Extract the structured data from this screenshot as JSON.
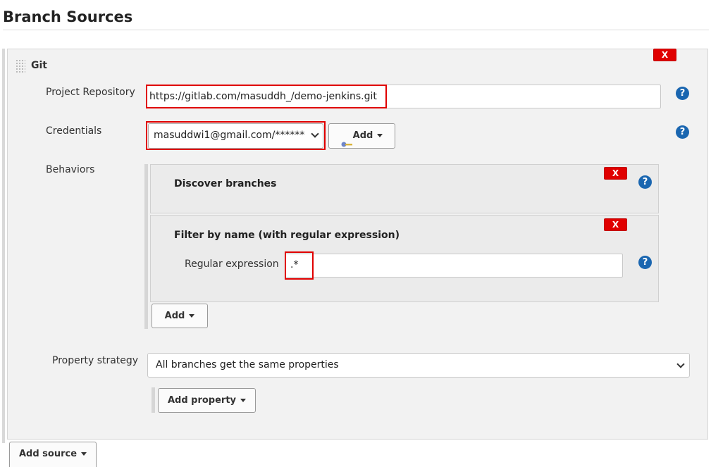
{
  "section": {
    "title": "Branch Sources"
  },
  "git": {
    "label": "Git",
    "delete_label": "X"
  },
  "project_repository": {
    "label": "Project Repository",
    "value": "https://gitlab.com/masuddh_/demo-jenkins.git"
  },
  "credentials": {
    "label": "Credentials",
    "selected": "masuddwi1@gmail.com/******",
    "add_label": "Add"
  },
  "behaviors": {
    "label": "Behaviors",
    "items": [
      {
        "title": "Discover branches",
        "delete_label": "X"
      },
      {
        "title": "Filter by name (with regular expression)",
        "delete_label": "X",
        "field_label": "Regular expression",
        "field_value": ".*"
      }
    ],
    "add_label": "Add"
  },
  "property_strategy": {
    "label": "Property strategy",
    "selected": "All branches get the same properties",
    "add_property_label": "Add property"
  },
  "add_source_label": "Add source",
  "help_label": "?",
  "colors": {
    "delete": "#e00000",
    "help": "#1a66b0",
    "highlight": "#e00000"
  }
}
